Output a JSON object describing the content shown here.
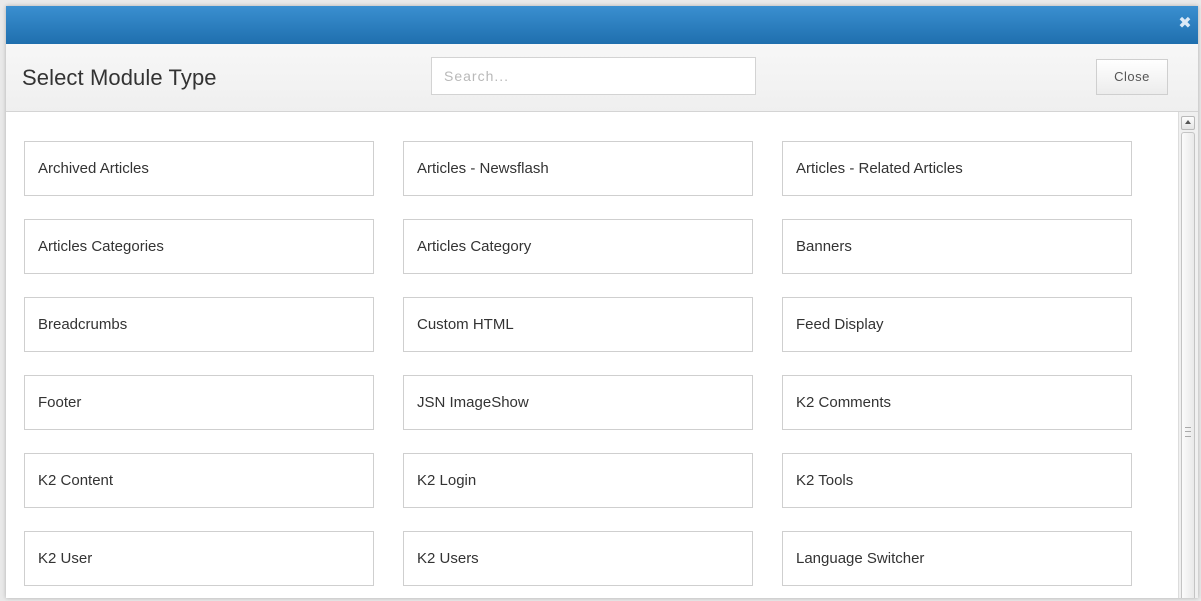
{
  "dialog": {
    "title": "Select Module Type",
    "search_placeholder": "Search...",
    "close_label": "Close",
    "titlebar_close_icon": "close-icon"
  },
  "modules": [
    {
      "label": "Archived Articles"
    },
    {
      "label": "Articles - Newsflash"
    },
    {
      "label": "Articles - Related Articles"
    },
    {
      "label": "Articles Categories"
    },
    {
      "label": "Articles Category"
    },
    {
      "label": "Banners"
    },
    {
      "label": "Breadcrumbs"
    },
    {
      "label": "Custom HTML"
    },
    {
      "label": "Feed Display"
    },
    {
      "label": "Footer"
    },
    {
      "label": "JSN ImageShow"
    },
    {
      "label": "K2 Comments"
    },
    {
      "label": "K2 Content"
    },
    {
      "label": "K2 Login"
    },
    {
      "label": "K2 Tools"
    },
    {
      "label": "K2 User"
    },
    {
      "label": "K2 Users"
    },
    {
      "label": "Language Switcher"
    }
  ],
  "colors": {
    "titlebar_top": "#3a8fd0",
    "titlebar_bottom": "#1f6fae",
    "text": "#333333",
    "border": "#cfcfcf"
  }
}
